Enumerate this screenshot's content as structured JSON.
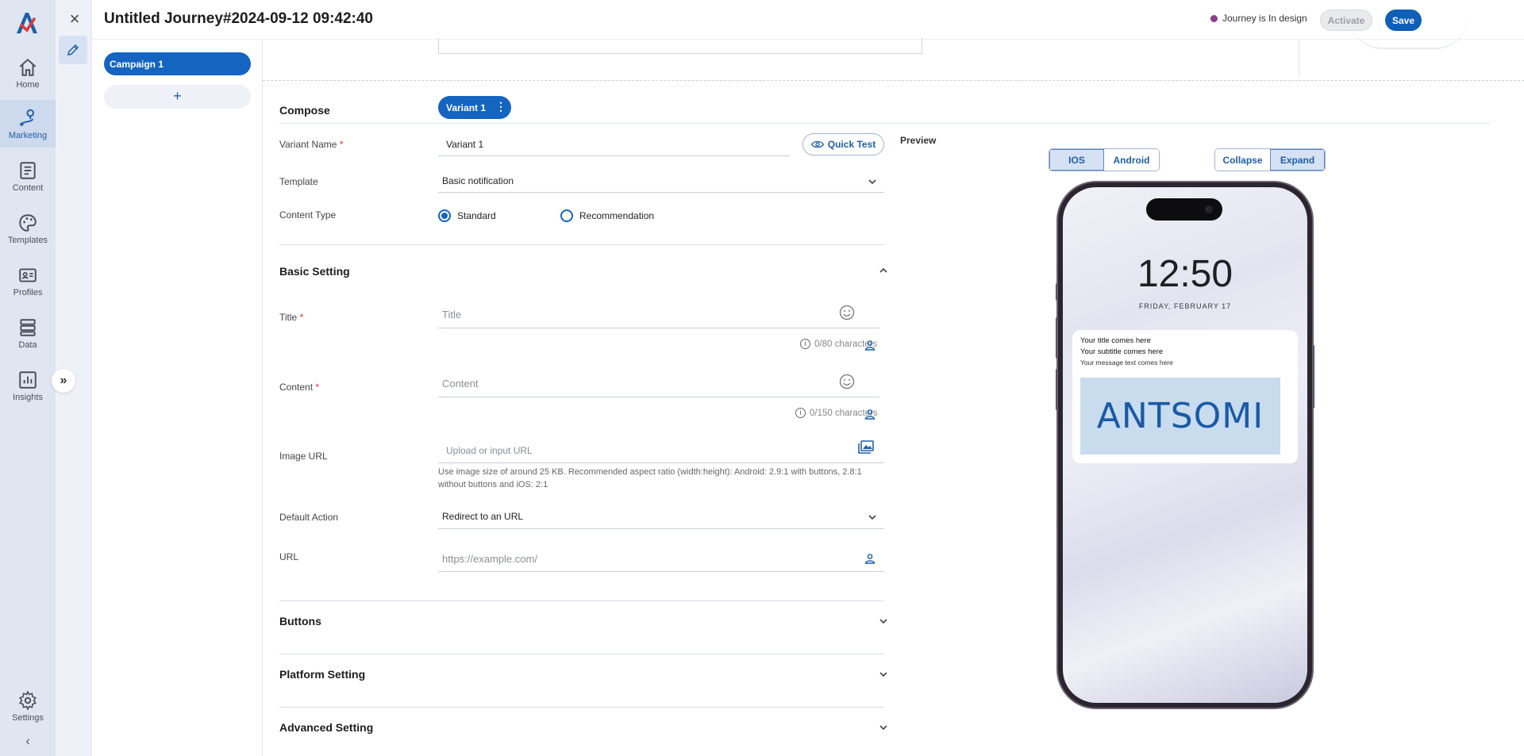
{
  "nav": {
    "items": [
      {
        "label": "Home",
        "icon": "home-icon"
      },
      {
        "label": "Marketing",
        "icon": "marketing-icon"
      },
      {
        "label": "Content",
        "icon": "content-icon"
      },
      {
        "label": "Templates",
        "icon": "palette-icon"
      },
      {
        "label": "Profiles",
        "icon": "profile-card-icon"
      },
      {
        "label": "Data",
        "icon": "database-icon"
      },
      {
        "label": "Insights",
        "icon": "chart-icon"
      }
    ],
    "settings_label": "Settings"
  },
  "header": {
    "title": "Untitled Journey#2024-09-12 09:42:40",
    "status": "Journey is In design",
    "activate_label": "Activate",
    "save_label": "Save"
  },
  "campaigns": {
    "items": [
      "Campaign 1"
    ],
    "add_label": "+"
  },
  "compose": {
    "label": "Compose",
    "variant_tab": "Variant 1",
    "variant_name_label": "Variant Name",
    "variant_name_value": "Variant 1",
    "quick_test_label": "Quick Test",
    "template_label": "Template",
    "template_value": "Basic notification",
    "content_type_label": "Content Type",
    "content_type_options": [
      "Standard",
      "Recommendation"
    ],
    "content_type_selected": "Standard"
  },
  "basic_setting": {
    "title": "Basic Setting",
    "title_label": "Title",
    "title_placeholder": "Title",
    "title_counter": "0/80 characters",
    "content_label": "Content",
    "content_placeholder": "Content",
    "content_counter": "0/150 characters",
    "image_url_label": "Image URL",
    "image_url_placeholder": "Upload or input URL",
    "image_hint": "Use image size of around 25 KB. Recommended aspect ratio (width:height): Android: 2.9:1 with buttons, 2.8:1 without buttons and iOS: 2:1",
    "default_action_label": "Default Action",
    "default_action_value": "Redirect to an URL",
    "url_label": "URL",
    "url_placeholder": "https://example.com/"
  },
  "sections": [
    "Buttons",
    "Platform Setting",
    "Advanced Setting"
  ],
  "preview": {
    "label": "Preview",
    "platforms": [
      "IOS",
      "Android"
    ],
    "platform_selected": "IOS",
    "modes": [
      "Collapse",
      "Expand"
    ],
    "mode_selected": "Expand",
    "time": "12:50",
    "date": "FRIDAY, FEBRUARY 17",
    "notif_title": "Your title comes here",
    "notif_subtitle": "Your subtitle comes here",
    "notif_message": "Your message text comes here",
    "image_logo": "ANTSOMI"
  },
  "colors": {
    "primary": "#1464c0",
    "status_dot": "#8a3f8c",
    "required": "#d9302b"
  }
}
